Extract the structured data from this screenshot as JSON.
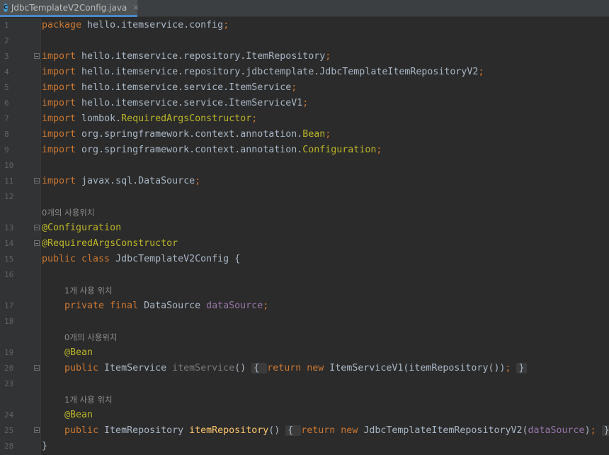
{
  "tab": {
    "title": "JdbcTemplateV2Config.java",
    "icon_letter": "C",
    "close_glyph": "×"
  },
  "lines": [
    {
      "num": "1",
      "tokens": [
        [
          "kw",
          "package "
        ],
        [
          "p",
          "hello.itemservice.config"
        ],
        [
          "kw",
          ";"
        ]
      ]
    },
    {
      "num": "2",
      "tokens": []
    },
    {
      "num": "3",
      "fold": true,
      "tokens": [
        [
          "kw",
          "import "
        ],
        [
          "p",
          "hello.itemservice.repository.ItemRepository"
        ],
        [
          "kw",
          ";"
        ]
      ]
    },
    {
      "num": "4",
      "tokens": [
        [
          "kw",
          "import "
        ],
        [
          "p",
          "hello.itemservice.repository.jdbctemplate.JdbcTemplateItemRepositoryV2"
        ],
        [
          "kw",
          ";"
        ]
      ]
    },
    {
      "num": "5",
      "tokens": [
        [
          "kw",
          "import "
        ],
        [
          "p",
          "hello.itemservice.service.ItemService"
        ],
        [
          "kw",
          ";"
        ]
      ]
    },
    {
      "num": "6",
      "tokens": [
        [
          "kw",
          "import "
        ],
        [
          "p",
          "hello.itemservice.service.ItemServiceV1"
        ],
        [
          "kw",
          ";"
        ]
      ]
    },
    {
      "num": "7",
      "tokens": [
        [
          "kw",
          "import "
        ],
        [
          "p",
          "lombok."
        ],
        [
          "ann",
          "RequiredArgsConstructor"
        ],
        [
          "kw",
          ";"
        ]
      ]
    },
    {
      "num": "8",
      "tokens": [
        [
          "kw",
          "import "
        ],
        [
          "p",
          "org.springframework.context.annotation."
        ],
        [
          "ann",
          "Bean"
        ],
        [
          "kw",
          ";"
        ]
      ]
    },
    {
      "num": "9",
      "tokens": [
        [
          "kw",
          "import "
        ],
        [
          "p",
          "org.springframework.context.annotation."
        ],
        [
          "ann",
          "Configuration"
        ],
        [
          "kw",
          ";"
        ]
      ]
    },
    {
      "num": "10",
      "tokens": []
    },
    {
      "num": "11",
      "fold": true,
      "tokens": [
        [
          "kw",
          "import "
        ],
        [
          "p",
          "javax.sql.DataSource"
        ],
        [
          "kw",
          ";"
        ]
      ]
    },
    {
      "num": "12",
      "tokens": []
    },
    {
      "hint": "0개의 사용위치"
    },
    {
      "num": "13",
      "fold": true,
      "tokens": [
        [
          "ann",
          "@Configuration"
        ]
      ]
    },
    {
      "num": "14",
      "fold": true,
      "tokens": [
        [
          "ann",
          "@RequiredArgsConstructor"
        ]
      ]
    },
    {
      "num": "15",
      "tokens": [
        [
          "kw",
          "public class "
        ],
        [
          "p",
          "JdbcTemplateV2Config {"
        ]
      ]
    },
    {
      "num": "16",
      "tokens": []
    },
    {
      "hint": "1개 사용 위치",
      "indent": true
    },
    {
      "num": "17",
      "indent": true,
      "tokens": [
        [
          "kw",
          "private final "
        ],
        [
          "p",
          "DataSource "
        ],
        [
          "fld",
          "dataSource"
        ],
        [
          "kw",
          ";"
        ]
      ]
    },
    {
      "num": "18",
      "tokens": []
    },
    {
      "hint": "0개의 사용위치",
      "indent": true
    },
    {
      "num": "19",
      "indent": true,
      "tokens": [
        [
          "ann",
          "@Bean"
        ]
      ]
    },
    {
      "num": "20",
      "indent": true,
      "fold": true,
      "tokens": [
        [
          "kw",
          "public "
        ],
        [
          "p",
          "ItemService "
        ],
        [
          "gray",
          "itemService"
        ],
        [
          "p",
          "() "
        ],
        [
          "box",
          "{ "
        ],
        [
          "kw",
          "return new "
        ],
        [
          "p",
          "ItemServiceV1(itemRepository())"
        ],
        [
          "kw",
          "; "
        ],
        [
          "box",
          "}"
        ]
      ]
    },
    {
      "num": "23",
      "tokens": []
    },
    {
      "hint": "1개 사용 위치",
      "indent": true
    },
    {
      "num": "24",
      "indent": true,
      "tokens": [
        [
          "ann",
          "@Bean"
        ]
      ]
    },
    {
      "num": "25",
      "indent": true,
      "fold": true,
      "tokens": [
        [
          "kw",
          "public "
        ],
        [
          "p",
          "ItemRepository "
        ],
        [
          "fn",
          "itemRepository"
        ],
        [
          "p",
          "() "
        ],
        [
          "box",
          "{ "
        ],
        [
          "kw",
          "return new "
        ],
        [
          "p",
          "JdbcTemplateItemRepositoryV2("
        ],
        [
          "fld",
          "dataSource"
        ],
        [
          "p",
          ")"
        ],
        [
          "kw",
          "; "
        ],
        [
          "box",
          "}"
        ]
      ]
    },
    {
      "num": "28",
      "tokens": [
        [
          "p",
          "}"
        ]
      ]
    }
  ]
}
